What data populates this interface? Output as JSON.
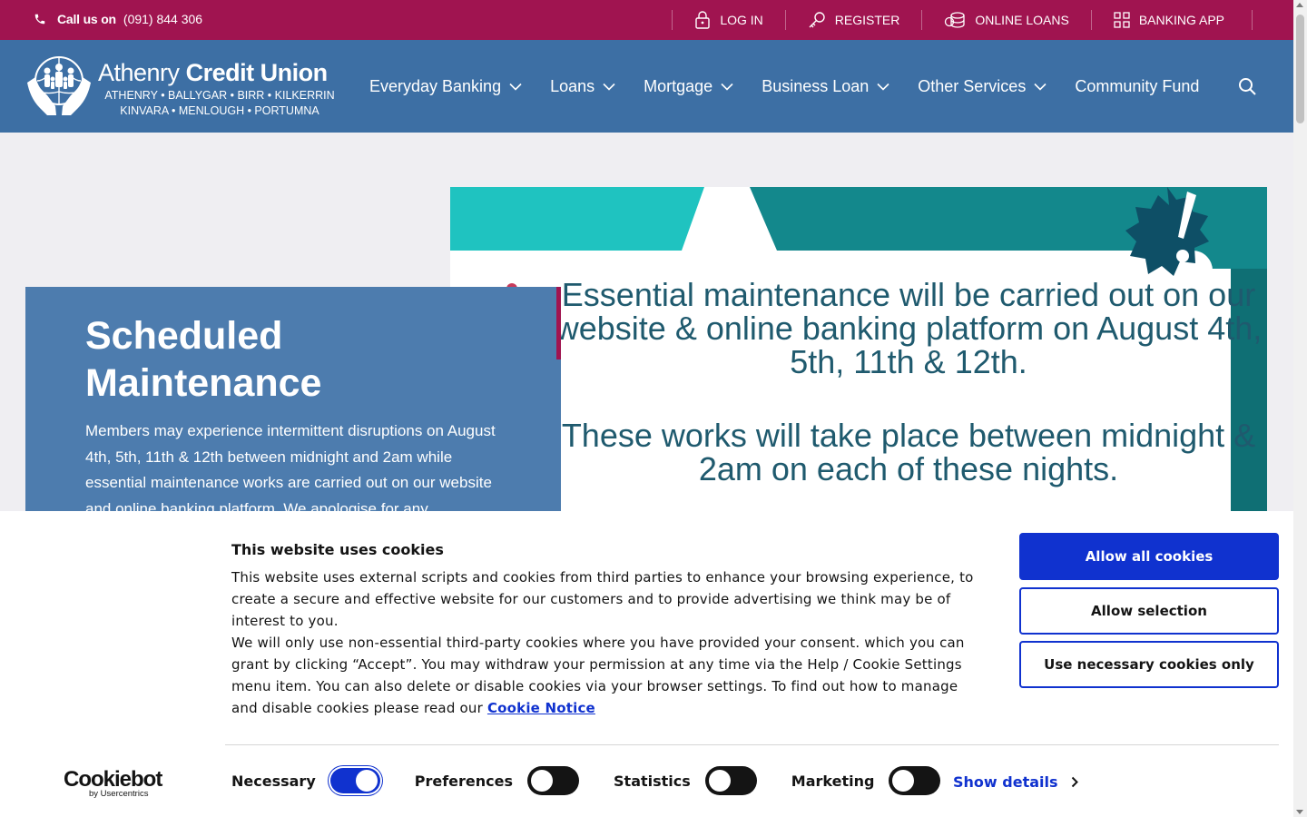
{
  "topbar": {
    "call_label": "Call us on",
    "phone": "(091) 844 306",
    "links": [
      {
        "label": "LOG IN",
        "icon": "lock-icon"
      },
      {
        "label": "REGISTER",
        "icon": "key-icon"
      },
      {
        "label": "ONLINE LOANS",
        "icon": "coins-icon"
      },
      {
        "label": "BANKING APP",
        "icon": "grid-icon"
      }
    ]
  },
  "logo": {
    "name_light": "Athenry",
    "name_bold": "Credit Union",
    "towns_line1": "ATHENRY • BALLYGAR • BIRR • KILKERRIN",
    "towns_line2": "KINVARA • MENLOUGH • PORTUMNA"
  },
  "nav": {
    "items": [
      {
        "label": "Everyday Banking",
        "has_dropdown": true
      },
      {
        "label": "Loans",
        "has_dropdown": true
      },
      {
        "label": "Mortgage",
        "has_dropdown": true
      },
      {
        "label": "Business Loan",
        "has_dropdown": true
      },
      {
        "label": "Other Services",
        "has_dropdown": true
      },
      {
        "label": "Community Fund",
        "has_dropdown": false
      }
    ]
  },
  "hero": {
    "title": "Scheduled Maintenance",
    "body": "Members may experience intermittent disruptions on August 4th, 5th, 11th & 12th between midnight and 2am while essential maintenance works are carried out on our website and online banking platform. We apologise for any",
    "banner_line1": "Essential maintenance will be carried out on our website & online banking platform on August 4th, 5th, 11th & 12th.",
    "banner_line2": "These works will take place between midnight & 2am on each of these nights."
  },
  "cookie": {
    "title": "This website uses cookies",
    "text1": "This website uses external scripts and cookies from third parties to enhance your browsing experience, to create a secure and effective website for our customers and to provide advertising we think may be of interest to you.",
    "text2": "We will only use non-essential third-party cookies where you have provided your consent. which you can grant by clicking “Accept”. You may withdraw your permission at any time via the Help / Cookie Settings menu item. You can also delete or disable cookies via your browser settings. To find out how to manage and disable cookies please read our",
    "link": "Cookie Notice",
    "btn_allow_all": "Allow all cookies",
    "btn_allow_selection": "Allow selection",
    "btn_necessary": "Use necessary cookies only",
    "brand": "Cookiebot",
    "brand_sub": "by Usercentrics",
    "toggles": [
      {
        "label": "Necessary",
        "on": true
      },
      {
        "label": "Preferences",
        "on": false
      },
      {
        "label": "Statistics",
        "on": false
      },
      {
        "label": "Marketing",
        "on": false
      }
    ],
    "show_details": "Show details"
  },
  "colors": {
    "topbar": "#a01450",
    "nav": "#3d6fa4",
    "card": "#4d7cae",
    "cookie_primary": "#1032cf"
  }
}
